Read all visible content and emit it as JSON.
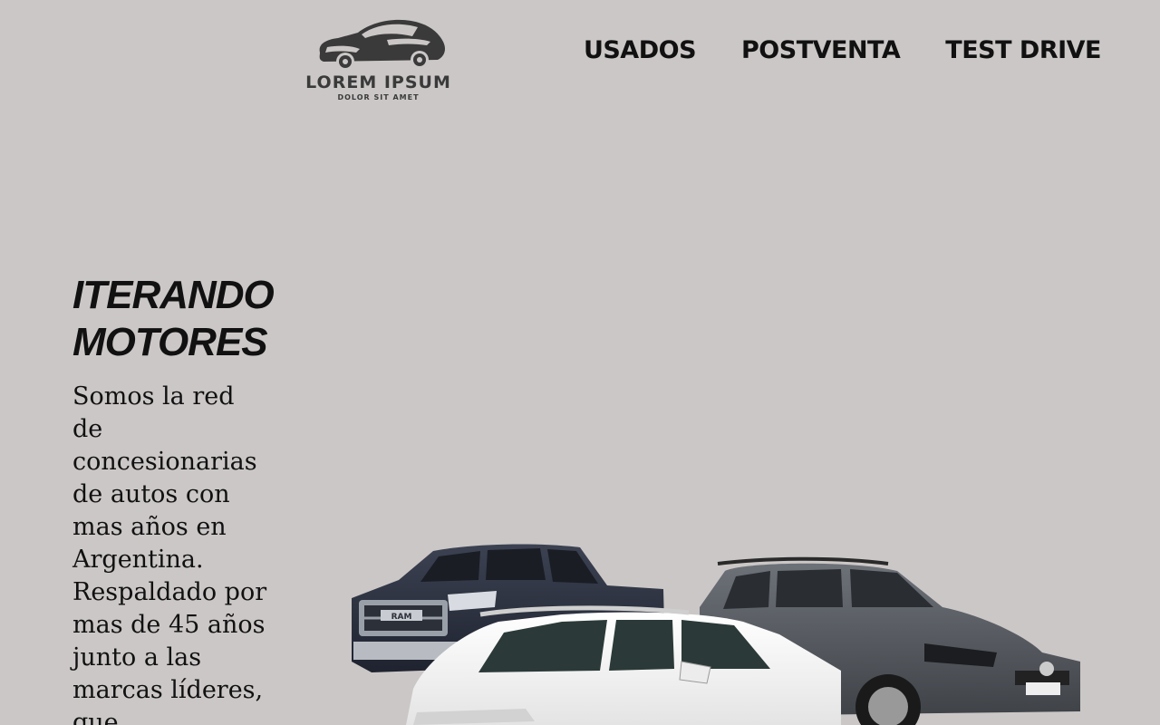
{
  "header": {
    "logo": {
      "title": "LOREM IPSUM",
      "subtitle": "DOLOR SIT AMET",
      "icon": "sports-car-icon"
    },
    "nav": [
      {
        "label": "USADOS"
      },
      {
        "label": "POSTVENTA"
      },
      {
        "label": "TEST DRIVE"
      }
    ]
  },
  "hero": {
    "title_line1": "ITERANDO",
    "title_line2": "MOTORES",
    "text": "Somos la red de concesionarias de autos con mas años en Argentina. Respaldado por mas de 45 años junto a las marcas líderes, que"
  },
  "image": {
    "description_icon": "cars-lineup-image",
    "ram_badge": "RAM"
  },
  "colors": {
    "background": "#cbc7c6",
    "text": "#111111",
    "logo": "#3a3a3a"
  }
}
